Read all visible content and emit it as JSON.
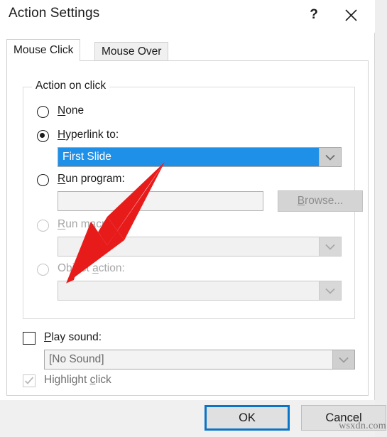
{
  "window": {
    "title": "Action Settings",
    "help_icon": "question-mark-icon",
    "close_icon": "close-icon",
    "help_label": "?",
    "close_label": "✕"
  },
  "tabs": [
    {
      "label": "Mouse Click",
      "active": true
    },
    {
      "label": "Mouse Over",
      "active": false
    }
  ],
  "group": {
    "legend": "Action on click",
    "options": [
      {
        "label_pre": "",
        "accel": "N",
        "label_post": "one",
        "selected": false,
        "enabled": true
      },
      {
        "label_pre": "",
        "accel": "H",
        "label_post": "yperlink to:",
        "selected": true,
        "enabled": true
      },
      {
        "label_pre": "",
        "accel": "R",
        "label_post": "un program:",
        "selected": false,
        "enabled": true
      },
      {
        "label_pre": "",
        "accel": "R",
        "label_post": "un macro:",
        "selected": false,
        "enabled": false
      },
      {
        "label_pre": "Object ",
        "accel": "a",
        "label_post": "ction:",
        "selected": false,
        "enabled": false
      }
    ],
    "hyperlink_combo": {
      "value": "First Slide",
      "highlighted": true
    },
    "run_program_field": {
      "value": "",
      "placeholder": ""
    },
    "browse_button": {
      "label_pre": "",
      "accel": "B",
      "label_post": "rowse..."
    },
    "run_macro_combo": {
      "value": ""
    },
    "object_action_combo": {
      "value": ""
    }
  },
  "play_sound": {
    "label_pre": "",
    "accel": "P",
    "label_post": "lay sound:",
    "checked": false,
    "combo_value": "[No Sound]"
  },
  "highlight_click": {
    "label_pre": "Highlight ",
    "accel": "c",
    "label_post": "lick",
    "checked": true,
    "enabled": false
  },
  "footer": {
    "ok_label": "OK",
    "cancel_label": "Cancel"
  },
  "watermark": "wsxdn.com",
  "colors": {
    "accent_blue": "#0a74c8",
    "selection_blue": "#1e90e8",
    "annotation_red": "#e81b1b",
    "dialog_bg": "#ffffff",
    "footer_bg": "#f0f0f0",
    "disabled_text": "#a6a6a6"
  }
}
